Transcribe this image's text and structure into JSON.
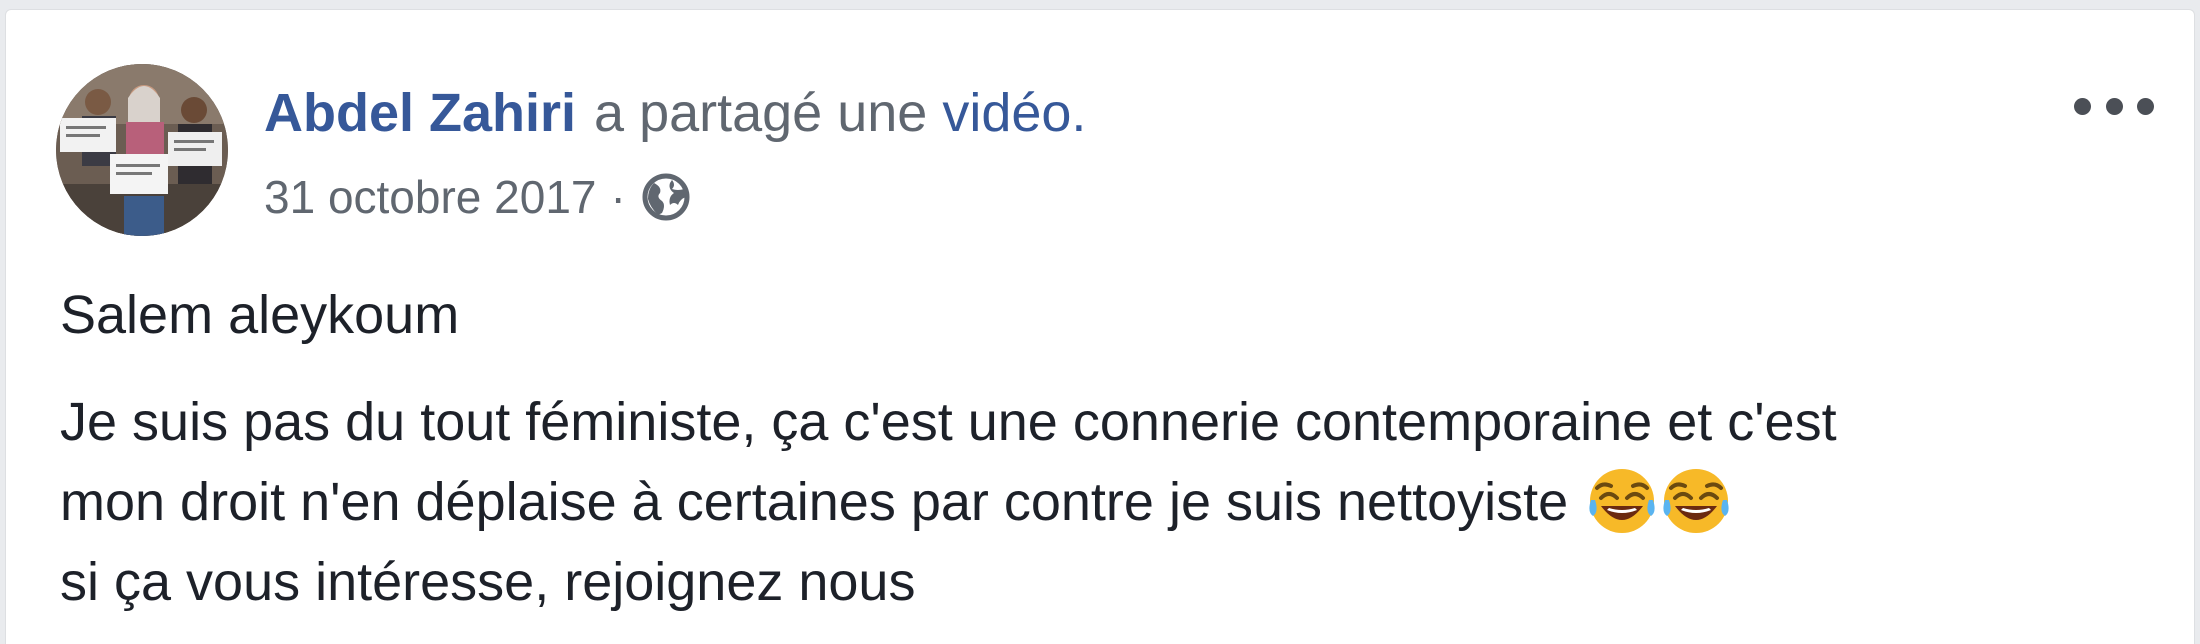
{
  "post": {
    "author": "Abdel Zahiri",
    "action_text": "a partagé une",
    "action_link": "vidéo.",
    "date": "31 octobre 2017",
    "separator": "·",
    "privacy_icon": "globe-icon",
    "menu_icon": "more-options-icon",
    "greeting": "Salem aleykoum",
    "message_lines": [
      "Je suis pas du tout féministe, ça c'est une connerie contemporaine et c'est",
      "mon droit n'en déplaise à certaines par contre je suis nettoyiste",
      "si ça vous intéresse, rejoignez nous"
    ],
    "emoji": [
      "face-with-tears-of-joy-emoji",
      "face-with-tears-of-joy-emoji"
    ]
  },
  "colors": {
    "link": "#365899",
    "secondary_text": "#606770",
    "primary_text": "#1d2129",
    "card_background": "#ffffff",
    "page_background": "#e9ebee"
  }
}
